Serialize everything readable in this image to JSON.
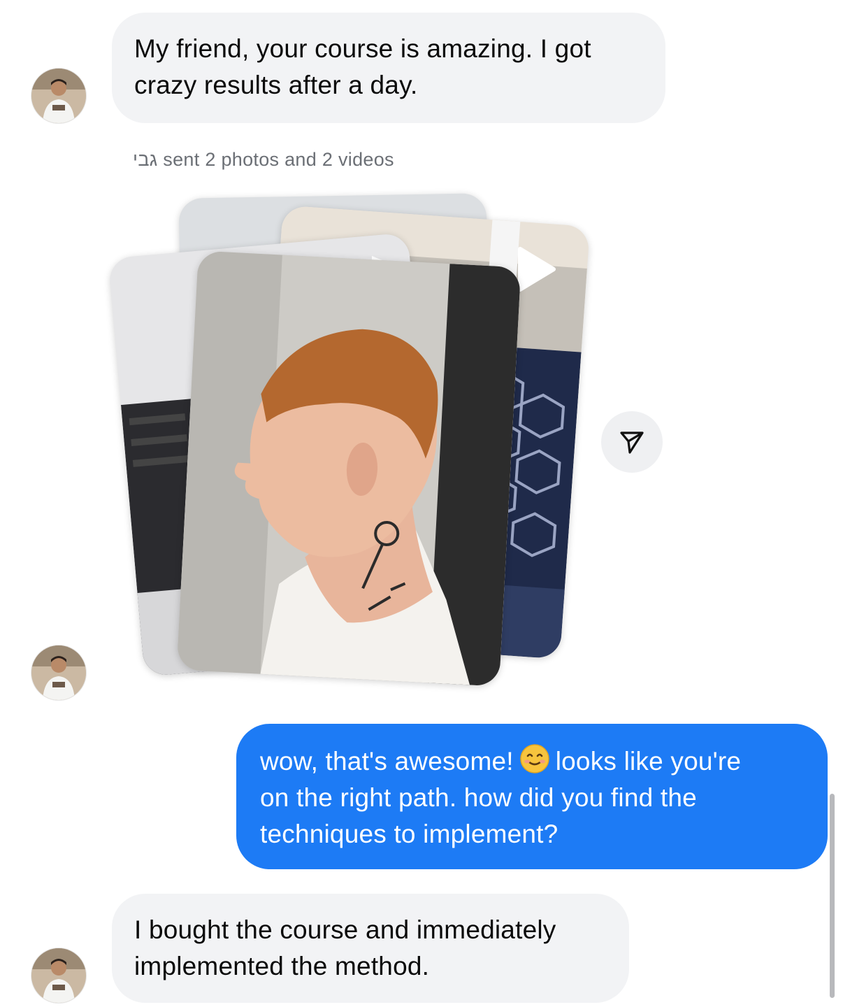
{
  "thread": {
    "messages": [
      {
        "direction": "incoming",
        "lines": [
          "My friend, your course is amazing. I got",
          "crazy results after a day."
        ]
      },
      {
        "direction": "incoming-system",
        "sender_name": "גבי",
        "text": "sent 2 photos and 2 videos"
      },
      {
        "direction": "outgoing",
        "lines_part1": "wow, that's awesome!",
        "lines_part2": "looks like you're",
        "line2": "on the right path. how did you find the",
        "line3": "techniques to implement?",
        "emoji": "smiling-face-emoji"
      },
      {
        "direction": "incoming",
        "lines": [
          "I bought the course and immediately",
          "implemented the method."
        ]
      }
    ]
  },
  "media": {
    "photo_count": 2,
    "video_count": 2,
    "icons": [
      "play-icon",
      "play-icon"
    ]
  },
  "share_button": {
    "icon": "send-icon"
  },
  "colors": {
    "incoming_bubble": "#f2f3f5",
    "outgoing_bubble": "#1d7bf5",
    "system_text": "#6b6f75"
  }
}
